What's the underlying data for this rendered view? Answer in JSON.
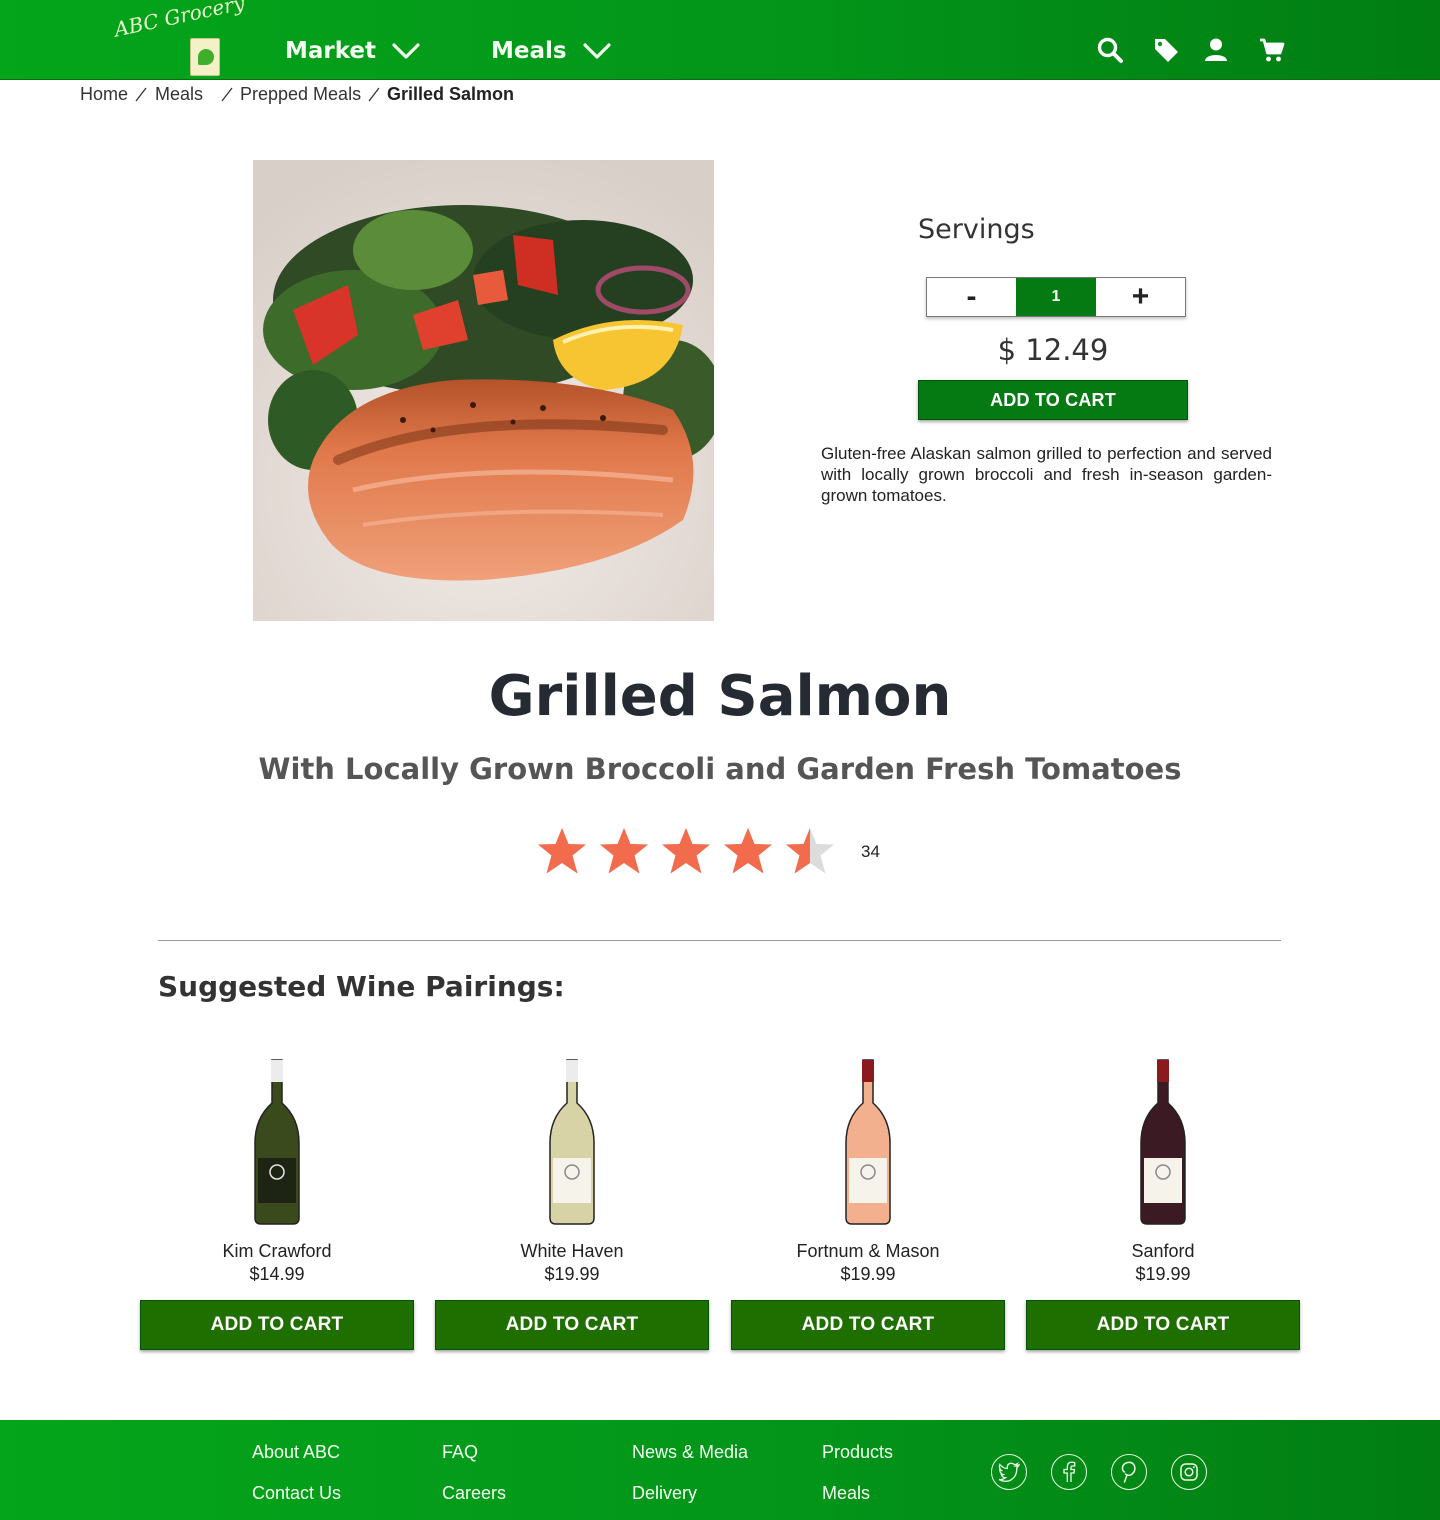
{
  "brand": {
    "logo_text": "ABC Grocery",
    "primary_color": "#04a51a",
    "button_color": "#057a12",
    "star_color": "#f26b4d"
  },
  "nav": {
    "market": "Market",
    "meals": "Meals",
    "icons": [
      "search-icon",
      "tag-icon",
      "account-icon",
      "cart-icon"
    ]
  },
  "breadcrumb": {
    "home": "Home",
    "meals": "Meals",
    "prepped": "Prepped Meals",
    "current": "Grilled Salmon"
  },
  "product": {
    "servings_label": "Servings",
    "minus": "-",
    "plus": "+",
    "quantity": "1",
    "price": "$ 12.49",
    "add_to_cart": "ADD TO CART",
    "description": "Gluten-free Alaskan salmon grilled to perfection and served with locally grown broccoli and fresh in-season garden-grown tomatoes.",
    "title": "Grilled Salmon",
    "subtitle": "With Locally Grown Broccoli and Garden Fresh Tomatoes",
    "rating_value": 4.5,
    "rating_max": 5,
    "rating_count": "34"
  },
  "wines": {
    "heading": "Suggested Wine Pairings:",
    "items": [
      {
        "name": "Kim Crawford",
        "price": "$14.99",
        "button": "ADD TO CART",
        "color": "#3a4a1c"
      },
      {
        "name": "White Haven",
        "price": "$19.99",
        "button": "ADD TO CART",
        "color": "#d8d3a6"
      },
      {
        "name": "Fortnum & Mason",
        "price": "$19.99",
        "button": "ADD TO CART",
        "color": "#f3b08e"
      },
      {
        "name": "Sanford",
        "price": "$19.99",
        "button": "ADD TO CART",
        "color": "#3b1a24"
      }
    ]
  },
  "footer": {
    "about": "About ABC",
    "contact": "Contact Us",
    "faq": "FAQ",
    "careers": "Careers",
    "news": "News & Media",
    "delivery": "Delivery",
    "products": "Products",
    "meals": "Meals",
    "social": [
      "twitter-icon",
      "facebook-icon",
      "pinterest-icon",
      "instagram-icon"
    ]
  }
}
